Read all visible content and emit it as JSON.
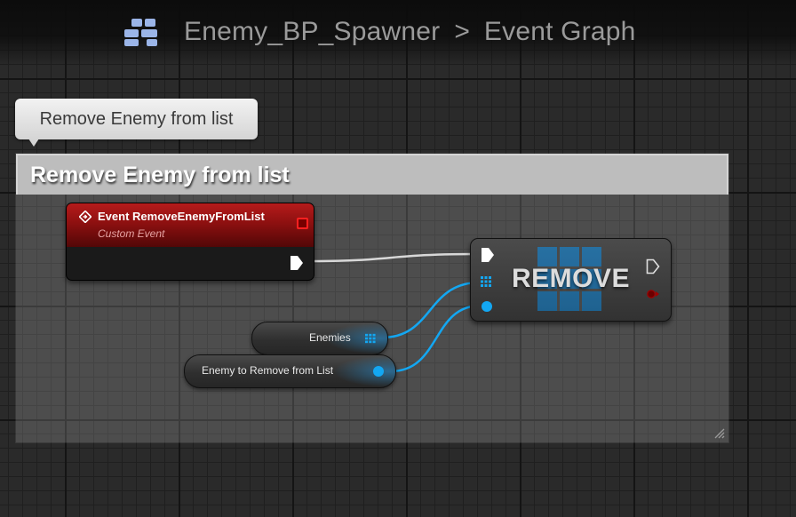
{
  "breadcrumb": {
    "icon": "blueprint-grid-icon",
    "asset": "Enemy_BP_Spawner",
    "separator": ">",
    "graph": "Event Graph"
  },
  "tooltip": {
    "text": "Remove Enemy from list"
  },
  "comment": {
    "title": "Remove Enemy from list"
  },
  "nodes": {
    "event": {
      "title": "Event RemoveEnemyFromList",
      "subtitle": "Custom Event",
      "icon": "event-diamond-icon"
    },
    "remove": {
      "title": "REMOVE",
      "icon": "array-grid-icon"
    },
    "enemies_var": {
      "label": "Enemies",
      "pin_icon": "array-pin-icon"
    },
    "enemy_var": {
      "label": "Enemy to Remove from List",
      "pin_icon": "object-pin-icon"
    }
  },
  "colors": {
    "event_header": "#8d1010",
    "object_pin": "#13a7f2",
    "exec_wire": "#e0e0e0",
    "delegate_pin": "#ff2020",
    "graph_bg": "#2a2a2a"
  }
}
